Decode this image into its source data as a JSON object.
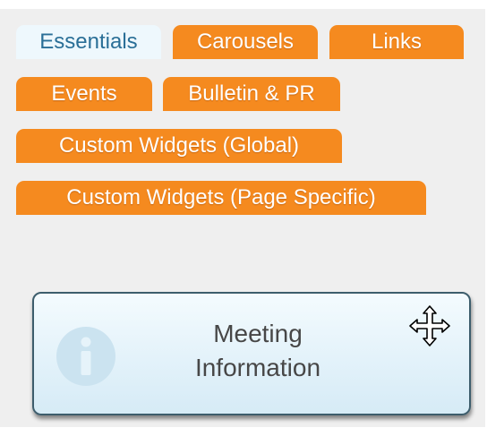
{
  "tabs": [
    {
      "label": "Essentials",
      "state": "active"
    },
    {
      "label": "Carousels",
      "state": "inactive"
    },
    {
      "label": "Links",
      "state": "inactive"
    },
    {
      "label": "Events",
      "state": "inactive"
    },
    {
      "label": "Bulletin & PR",
      "state": "inactive"
    },
    {
      "label": "Custom Widgets (Global)",
      "state": "inactive"
    },
    {
      "label": "Custom Widgets (Page Specific)",
      "state": "inactive"
    }
  ],
  "widget": {
    "title_line1": "Meeting",
    "title_line2": "Information",
    "icon": "info-icon",
    "drag_icon": "move-icon"
  },
  "colors": {
    "tab_inactive": "#f58a1f",
    "tab_active_bg": "#eef8fd",
    "tab_active_text": "#2a6f97",
    "panel_bg": "#efefef",
    "widget_border": "#3d5d6c"
  }
}
